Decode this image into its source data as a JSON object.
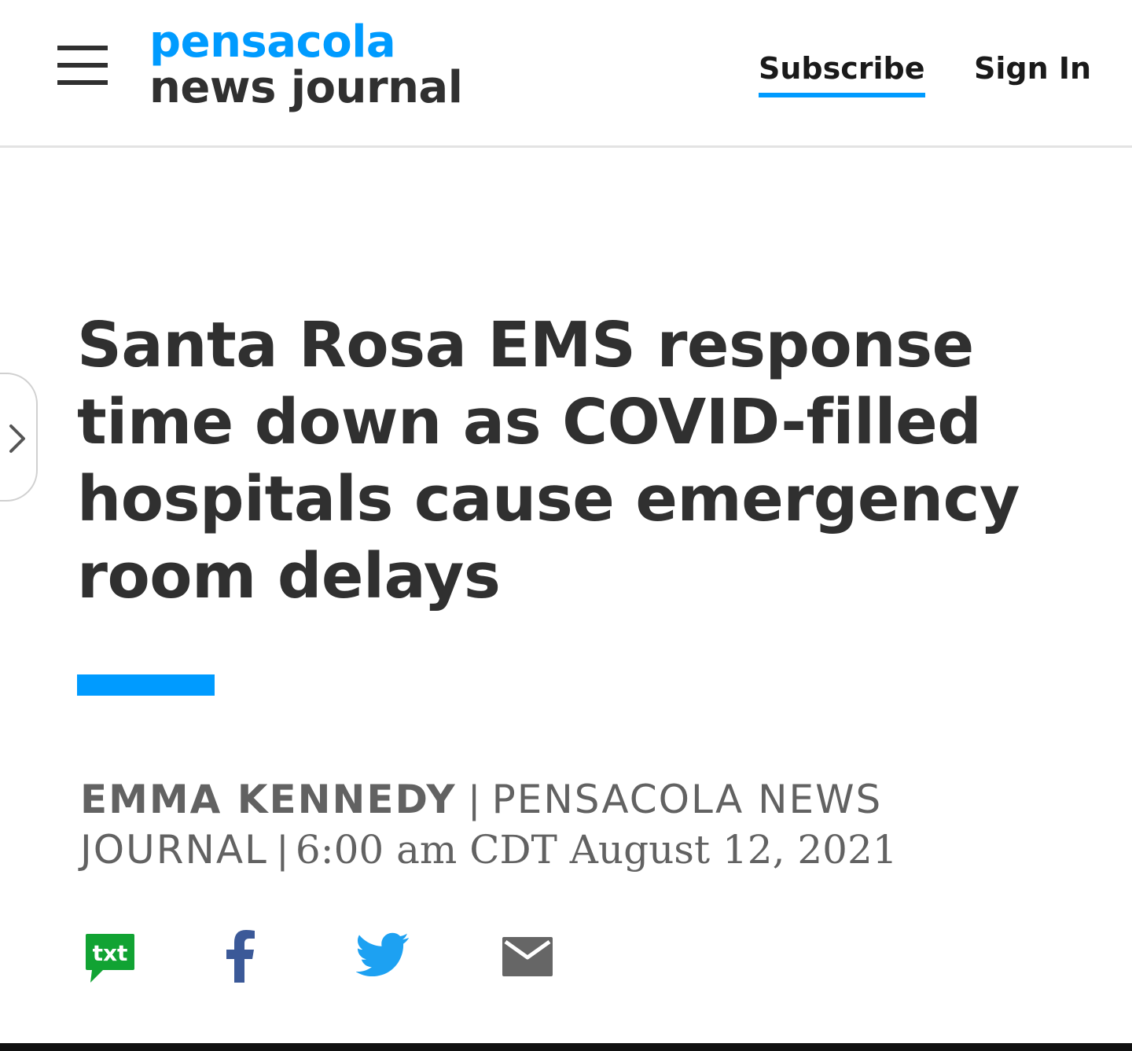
{
  "header": {
    "logo_line1": "pensacola",
    "logo_line2": "news journal",
    "subscribe_label": "Subscribe",
    "signin_label": "Sign In"
  },
  "article": {
    "headline": "Santa Rosa EMS response time down as COVID-filled hospitals cause emergency room delays",
    "author": "EMMA KENNEDY",
    "separator": "|",
    "source_line1": "PENSACOLA NEWS",
    "source_line2": "JOURNAL",
    "date_separator": "|",
    "timestamp": "6:00 am CDT August 12, 2021"
  },
  "share": {
    "txt_label": "txt",
    "icons": [
      "sms-share-icon",
      "facebook-icon",
      "twitter-icon",
      "email-icon"
    ]
  },
  "colors": {
    "brand_blue": "#009bff",
    "text_dark": "#303030",
    "byline_gray": "#626262",
    "sms_green": "#11a333",
    "facebook_blue": "#3b5998",
    "twitter_blue": "#1da1f2",
    "mail_gray": "#666666"
  }
}
